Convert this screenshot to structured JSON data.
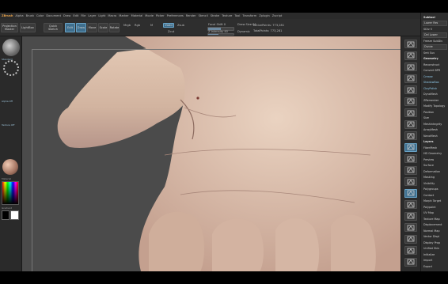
{
  "app": {
    "title": "ZBrush"
  },
  "menu": [
    "Alpha",
    "Brush",
    "Color",
    "Document",
    "Draw",
    "Edit",
    "File",
    "Layer",
    "Light",
    "Macro",
    "Marker",
    "Material",
    "Movie",
    "Picker",
    "Preferences",
    "Render",
    "Stencil",
    "Stroke",
    "Texture",
    "Tool",
    "Transform",
    "Zplugin",
    "Zscript"
  ],
  "toptray": {
    "btn_projection": "Projection Master",
    "btn_lightbox": "LightBox",
    "btn_quicksketch": "Quick Sketch",
    "btn_edit": "Edit",
    "btn_draw": "Draw",
    "btn_move": "Move",
    "btn_scale": "Scale",
    "btn_rotate": "Rotate",
    "mrgb": "Mrgb",
    "rgb": "Rgb",
    "m": "M",
    "zadd": "Zadd",
    "zsub": "Zsub",
    "zcut": "Zcut",
    "focal_shift_label": "Focal Shift 0",
    "z_intensity_label": "Z Intensity 40",
    "draw_size_label": "Draw Size 64",
    "dynamic_label": "Dynamic",
    "active_points": "ActivePoints: 773,281",
    "total_points": "TotalPoints: 773,281"
  },
  "leftshelf": {
    "label1": "Standard",
    "label2": "Alpha Off",
    "label3": "Texture Off",
    "label4": "Material",
    "label5": "Gradient"
  },
  "rightshelf_icons": [
    "bpr-icon",
    "spix-icon",
    "scroll-icon",
    "zoom-icon",
    "actual-icon",
    "aahalf-icon",
    "persp-icon",
    "floor-icon",
    "local-icon",
    "xyz-icon",
    "frame-icon",
    "move-icon",
    "scale-icon",
    "rotate-icon",
    "polyf-icon",
    "transp-icon",
    "ghost-icon",
    "solo-icon",
    "xpose-icon",
    "dynamic-icon"
  ],
  "tray": [
    {
      "label": "Subtool",
      "type": "head"
    },
    {
      "label": "Lower Res",
      "type": "btn"
    },
    {
      "label": "SDiv 5",
      "type": "text"
    },
    {
      "label": "Del Lower",
      "type": "btn"
    },
    {
      "label": "Freeze SubDiv",
      "type": "text"
    },
    {
      "label": "Divide",
      "type": "btn"
    },
    {
      "label": "Smt  Suv",
      "type": "text"
    },
    {
      "label": "Geometry",
      "type": "head"
    },
    {
      "label": "Reconstruct",
      "type": "text"
    },
    {
      "label": "Convert BPR",
      "type": "text"
    },
    {
      "label": "Crease",
      "type": "hl"
    },
    {
      "label": "ShadowBox",
      "type": "hl"
    },
    {
      "label": "ClayPolish",
      "type": "hl"
    },
    {
      "label": "DynaMesh",
      "type": "text"
    },
    {
      "label": "ZRemesher",
      "type": "text"
    },
    {
      "label": "Modify Topology",
      "type": "text"
    },
    {
      "label": "Position",
      "type": "text"
    },
    {
      "label": "Size",
      "type": "text"
    },
    {
      "label": "MeshIntegrity",
      "type": "text"
    },
    {
      "label": "ArrayMesh",
      "type": "text"
    },
    {
      "label": "NanoMesh",
      "type": "text"
    },
    {
      "label": "Layers",
      "type": "head"
    },
    {
      "label": "FiberMesh",
      "type": "text"
    },
    {
      "label": "HD Geometry",
      "type": "text"
    },
    {
      "label": "Preview",
      "type": "text"
    },
    {
      "label": "Surface",
      "type": "text"
    },
    {
      "label": "Deformation",
      "type": "text"
    },
    {
      "label": "Masking",
      "type": "text"
    },
    {
      "label": "Visibility",
      "type": "text"
    },
    {
      "label": "Polygroups",
      "type": "text"
    },
    {
      "label": "Contact",
      "type": "text"
    },
    {
      "label": "Morph Target",
      "type": "text"
    },
    {
      "label": "Polypaint",
      "type": "text"
    },
    {
      "label": "UV Map",
      "type": "text"
    },
    {
      "label": "Texture Map",
      "type": "text"
    },
    {
      "label": "Displacement",
      "type": "text"
    },
    {
      "label": "Normal Map",
      "type": "text"
    },
    {
      "label": "Vector Displ",
      "type": "text"
    },
    {
      "label": "Display Prop",
      "type": "text"
    },
    {
      "label": "Unified Skin",
      "type": "text"
    },
    {
      "label": "Initialize",
      "type": "text"
    },
    {
      "label": "Import",
      "type": "text"
    },
    {
      "label": "Export",
      "type": "text"
    }
  ]
}
